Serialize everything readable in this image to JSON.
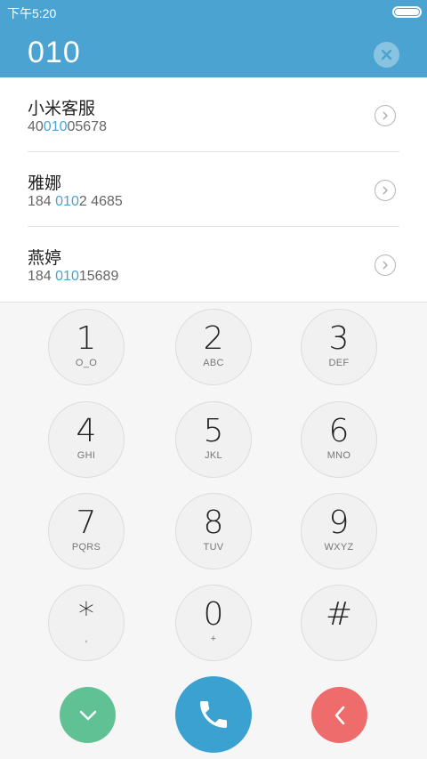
{
  "status": {
    "time": "下午5:20"
  },
  "dialed": "010",
  "results": [
    {
      "name": "小米客服",
      "num_pre": "40",
      "num_hl": "010",
      "num_post": "05678"
    },
    {
      "name": "雅娜",
      "num_pre": "184 ",
      "num_hl": "010",
      "num_post": "2 4685"
    },
    {
      "name": "燕婷",
      "num_pre": "184 ",
      "num_hl": "010",
      "num_post": "15689"
    }
  ],
  "keys": [
    {
      "digit": "1",
      "letters": "O_O"
    },
    {
      "digit": "2",
      "letters": "ABC"
    },
    {
      "digit": "3",
      "letters": "DEF"
    },
    {
      "digit": "4",
      "letters": "GHI"
    },
    {
      "digit": "5",
      "letters": "JKL"
    },
    {
      "digit": "6",
      "letters": "MNO"
    },
    {
      "digit": "7",
      "letters": "PQRS"
    },
    {
      "digit": "8",
      "letters": "TUV"
    },
    {
      "digit": "9",
      "letters": "WXYZ"
    },
    {
      "digit": "*",
      "letters": ","
    },
    {
      "digit": "0",
      "letters": "+"
    },
    {
      "digit": "#",
      "letters": ""
    }
  ],
  "colors": {
    "accent": "#4aa3d0",
    "green": "#60c195",
    "red": "#ee6c6c"
  },
  "icons": {
    "collapse": "chevron-down-icon",
    "call": "phone-icon",
    "delete": "chevron-left-icon",
    "clear": "close-icon",
    "detail": "chevron-right-icon"
  }
}
